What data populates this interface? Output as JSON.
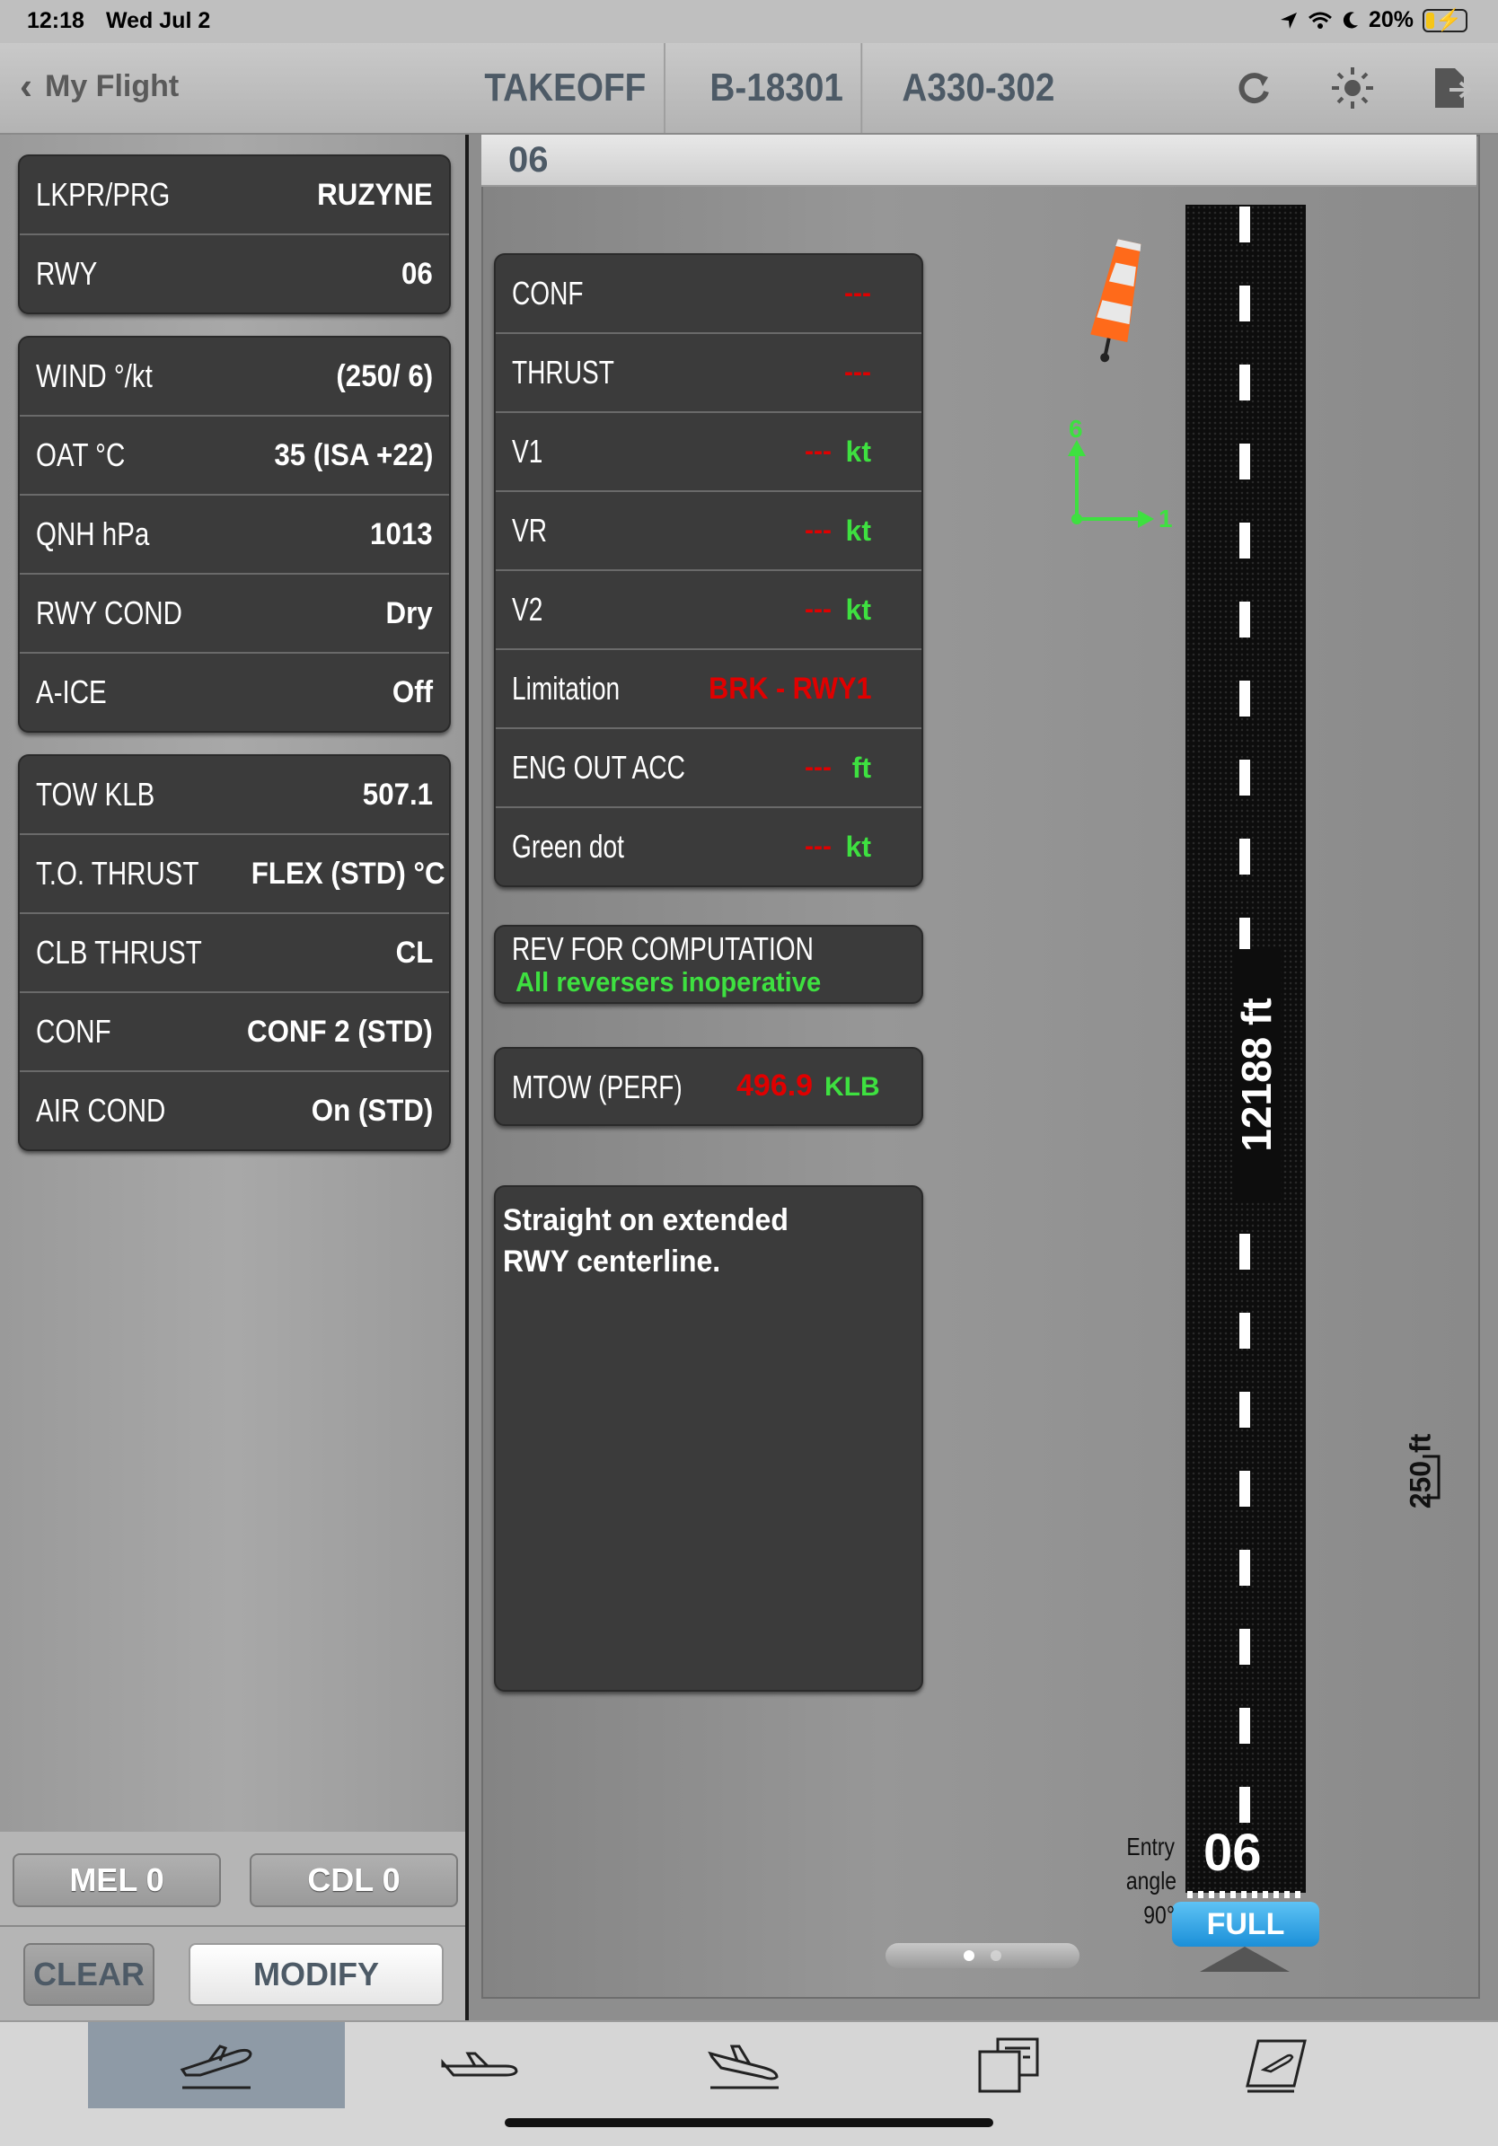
{
  "status_bar": {
    "time": "12:18",
    "date": "Wed Jul 2",
    "battery": "20%",
    "battery_level": 0.2
  },
  "nav": {
    "back_label": "My Flight",
    "titles": [
      "TAKEOFF",
      "B-18301",
      "A330-302"
    ],
    "icons": [
      "refresh-icon",
      "brightness-icon",
      "export-icon"
    ]
  },
  "left": {
    "airport": {
      "label": "LKPR/PRG",
      "value": "RUZYNE"
    },
    "rwy": {
      "label": "RWY",
      "value": "06"
    },
    "conditions": [
      {
        "label": "WIND  °/kt",
        "value": "(250/ 6)"
      },
      {
        "label": "OAT °C",
        "value": "35 (ISA +22)"
      },
      {
        "label": "QNH  hPa",
        "value": "1013"
      },
      {
        "label": "RWY COND",
        "value": "Dry"
      },
      {
        "label": "A-ICE",
        "value": "Off"
      }
    ],
    "aircraft": [
      {
        "label": "TOW  KLB",
        "value": "507.1"
      },
      {
        "label": "T.O. THRUST",
        "value": "FLEX (STD) °C"
      },
      {
        "label": "CLB THRUST",
        "value": "CL"
      },
      {
        "label": "CONF",
        "value": "CONF 2 (STD)"
      },
      {
        "label": "AIR COND",
        "value": "On (STD)"
      }
    ],
    "mel_label": "MEL 0",
    "cdl_label": "CDL 0",
    "clear_label": "CLEAR",
    "modify_label": "MODIFY"
  },
  "content": {
    "header": "06",
    "results": [
      {
        "label": "CONF",
        "value": "---",
        "unit": ""
      },
      {
        "label": "THRUST",
        "value": "---",
        "unit": ""
      },
      {
        "label": "V1",
        "value": "---",
        "unit": "kt"
      },
      {
        "label": "VR",
        "value": "---",
        "unit": "kt"
      },
      {
        "label": "V2",
        "value": "---",
        "unit": "kt"
      },
      {
        "label": "Limitation",
        "value": "BRK - RWY1",
        "unit": ""
      },
      {
        "label": "ENG OUT ACC",
        "value": "---",
        "unit": "ft"
      },
      {
        "label": "Green dot",
        "value": "---",
        "unit": "kt"
      }
    ],
    "rev": {
      "title": "REV FOR COMPUTATION",
      "value": "All reversers inoperative"
    },
    "mtow": {
      "label": "MTOW (PERF)",
      "value": "496.9",
      "unit": "KLB"
    },
    "notes": "Straight on extended RWY centerline.",
    "wind_components": {
      "head": "6",
      "cross": "1"
    },
    "runway": {
      "length": "12188 ft",
      "number": "06",
      "entry_lines": [
        "Entry",
        "angle",
        "90°"
      ],
      "full_label": "FULL",
      "offset": "250 ft"
    },
    "pages": {
      "count": 2,
      "current": 1
    }
  },
  "tabs": [
    {
      "name": "tab-takeoff",
      "icon": "takeoff-icon",
      "active": true
    },
    {
      "name": "tab-cruise",
      "icon": "aircraft-icon",
      "active": false
    },
    {
      "name": "tab-landing",
      "icon": "landing-icon",
      "active": false
    },
    {
      "name": "tab-documents",
      "icon": "documents-icon",
      "active": false
    },
    {
      "name": "tab-logbook",
      "icon": "logbook-icon",
      "active": false
    }
  ],
  "colors": {
    "alert": "#e00000",
    "ok": "#3ee040",
    "accent": "#1b8fd8"
  }
}
